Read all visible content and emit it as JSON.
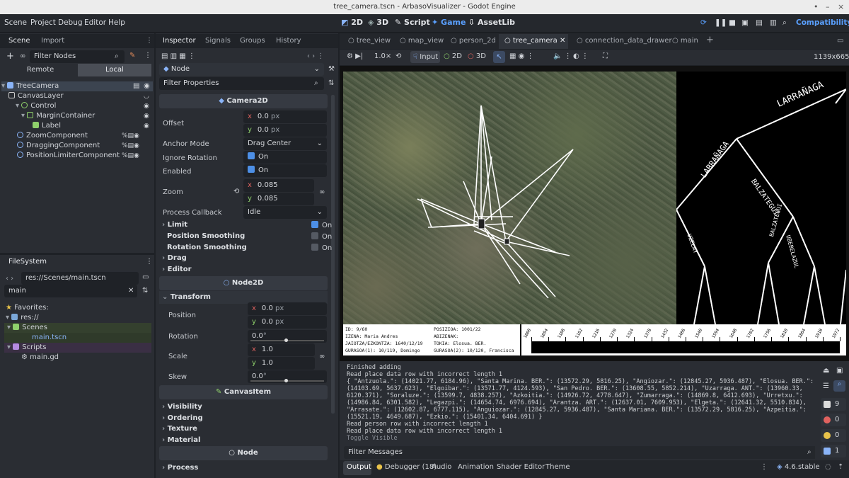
{
  "window": {
    "title": "tree_camera.tscn - ArbasoVisualizer - Godot Engine",
    "buttons": [
      "•",
      "–",
      "×"
    ]
  },
  "menu": [
    "Scene",
    "Project",
    "Debug",
    "Editor",
    "Help"
  ],
  "workspaces": [
    "2D",
    "3D",
    "Script",
    "Game",
    "AssetLib"
  ],
  "compat": "Compatibility",
  "scene_dock": {
    "tabs": [
      "Scene",
      "Import"
    ],
    "filter_placeholder": "Filter Nodes",
    "remote": "Remote",
    "local": "Local",
    "nodes": [
      "TreeCamera",
      "CanvasLayer",
      "Control",
      "MarginContainer",
      "Label",
      "ZoomComponent",
      "DraggingComponent",
      "PositionLimiterComponent"
    ]
  },
  "filesystem": {
    "title": "FileSystem",
    "path": "res://Scenes/main.tscn",
    "search": "main",
    "items": [
      "Favorites:",
      "res://",
      "Scenes",
      "main.tscn",
      "Scripts",
      "main.gd"
    ]
  },
  "inspector": {
    "tabs": [
      "Inspector",
      "Signals",
      "Groups",
      "History"
    ],
    "node": "Node",
    "filter_placeholder": "Filter Properties",
    "camera2d": "Camera2D",
    "offset": "Offset",
    "offset_x": "0.0",
    "offset_y": "0.0",
    "px": "px",
    "x": "x",
    "y": "y",
    "anchor_mode": "Anchor Mode",
    "anchor_value": "Drag Center",
    "ignore_rotation": "Ignore Rotation",
    "enabled": "Enabled",
    "on": "On",
    "zoom": "Zoom",
    "zoom_x": "0.085",
    "zoom_y": "0.085",
    "process_callback": "Process Callback",
    "process_value": "Idle",
    "limit": "Limit",
    "position_smoothing": "Position Smoothing",
    "rotation_smoothing": "Rotation Smoothing",
    "drag": "Drag",
    "editor": "Editor",
    "node2d": "Node2D",
    "transform": "Transform",
    "position": "Position",
    "pos_x": "0.0",
    "pos_y": "0.0",
    "rotation": "Rotation",
    "rot": "0.0",
    "deg": "°",
    "scale": "Scale",
    "scale_x": "1.0",
    "scale_y": "1.0",
    "skew": "Skew",
    "skew_val": "0.0",
    "canvasitem": "CanvasItem",
    "visibility": "Visibility",
    "ordering": "Ordering",
    "texture": "Texture",
    "material": "Material",
    "process": "Process"
  },
  "scene_tabs": [
    "tree_view",
    "map_view",
    "person_2d",
    "tree_camera",
    "connection_data_drawer",
    "main"
  ],
  "toolbar": {
    "zoom": "1.0×",
    "input": "Input",
    "d2": "2D",
    "d3": "3D",
    "size": "1139x665"
  },
  "game": {
    "tree_labels": [
      "LARRAÑAGA",
      "LARRAÑAGA",
      "BALZATEGUI",
      "UZELAY",
      "BALZATEGUI",
      "UBEBELAZUL"
    ],
    "info": {
      "id": "ID: 9/60",
      "posizioa": "POSIZIOA: 1001/22",
      "izena": "IZENA: Maria Andres",
      "abizenak": "ABIZENAK:",
      "jaiotza": "JAIOTZA/EZKONTZA: 1640/12/19",
      "tokia": "TOKIA: Elosua. BER.",
      "gurasoa1": "GURASOA(1): 10/119, Domingo",
      "gurasoa2": "GURASOA(2): 10/120, Francisca"
    },
    "years": [
      "1000",
      "1054",
      "1108",
      "1162",
      "1216",
      "1270",
      "1324",
      "1378",
      "1432",
      "1486",
      "1540",
      "1594",
      "1648",
      "1702",
      "1756",
      "1810",
      "1864",
      "1918",
      "1972"
    ]
  },
  "output": {
    "lines": [
      "Finished adding",
      "Read place data row with incorrect length 1",
      "{ \"Antzuola.\": (14021.77, 6184.96), \"Santa Marina. BER.\": (13572.29, 5816.25), \"Angiozar.\": (12845.27, 5936.487), \"Elosua. BER.\":",
      "(14103.69, 5637.623), \"Elgoibar.\": (13571.77, 4124.593), \"San Pedro. BER.\": (13608.55, 5852.214), \"Uzarraga. ANT.\": (13960.33,",
      "6120.371), \"Soraluze.\": (13599.7, 4838.257), \"Azkoitia.\": (14926.72, 4778.647), \"Zumarraga.\": (14869.8, 6412.693), \"Urretxu.\":",
      "(14986.84, 6301.582), \"Legazpi.\": (14654.74, 6976.694), \"Arantza. ART.\": (12637.01, 7609.953), \"Elgeta.\": (12641.32, 5510.834),",
      "\"Arrasate.\": (12602.87, 6777.115), \"Anguiozar.\": (12845.27, 5936.487), \"Santa Mariana. BER.\": (13572.29, 5816.25), \"Azpeitia.\":",
      "(15521.19, 4649.687), \"Ezkio.\": (15401.34, 6404.691) }",
      "Read person row with incorrect length 1",
      "Read place data row with incorrect length 1",
      "Toggle Visible"
    ],
    "filter_placeholder": "Filter Messages",
    "counts": [
      "9",
      "0",
      "0",
      "1"
    ]
  },
  "bottom_tabs": [
    "Output",
    "Debugger (18)",
    "Audio",
    "Animation",
    "Shader Editor",
    "Theme"
  ],
  "version": "4.6.stable"
}
